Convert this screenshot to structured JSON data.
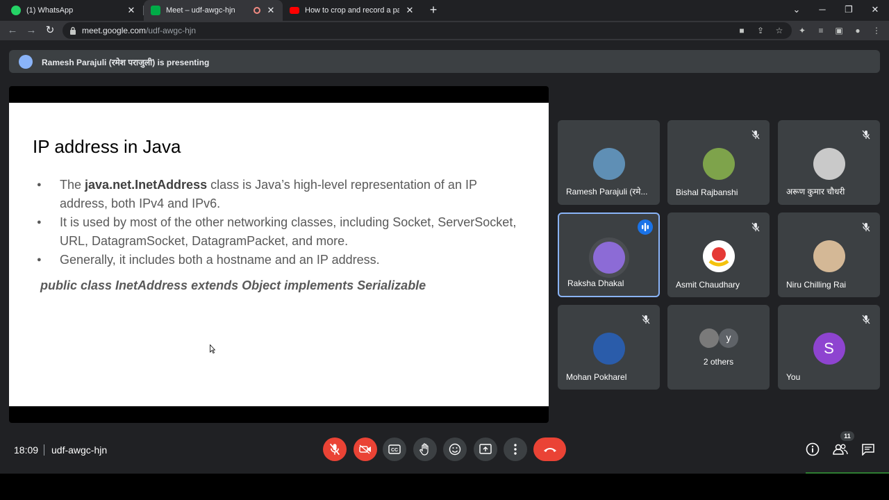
{
  "browser": {
    "tabs": [
      {
        "title": "(1) WhatsApp",
        "favicon": "whatsapp-icon",
        "color": "#25d366"
      },
      {
        "title": "Meet – udf-awgc-hjn",
        "favicon": "meet-icon",
        "color": "#00ac47"
      },
      {
        "title": "How to crop and record a partic",
        "favicon": "youtube-icon",
        "color": "#ff0000"
      }
    ],
    "url_host": "meet.google.com",
    "url_path": "/udf-awgc-hjn"
  },
  "meet": {
    "presenting_text": "Ramesh Parajuli (रमेश पराजुली) is presenting",
    "slide": {
      "title": "IP address in Java",
      "bullet1_pre": "The ",
      "bullet1_bold": "java.net.InetAddress",
      "bullet1_post": " class is Java’s high-level representation of an IP address, both IPv4 and IPv6.",
      "bullet2": "It is used by most of the other networking classes, including Socket, ServerSocket, URL, DatagramSocket, DatagramPacket, and more.",
      "bullet3": "Generally, it includes both a hostname and an IP address.",
      "signature": "public class InetAddress extends Object implements Serializable"
    },
    "participants": [
      {
        "name": "Ramesh Parajuli (रमे...",
        "muted": false,
        "avatar_color": "#5f8fb5"
      },
      {
        "name": "Bishal Rajbanshi",
        "muted": true,
        "avatar_color": "#7ea34b"
      },
      {
        "name": "अरूण कुमार चौधरी",
        "muted": true,
        "avatar_color": "#c9c9c9"
      },
      {
        "name": "Raksha Dhakal",
        "muted": false,
        "speaking": true,
        "avatar_color": "#8c6bd6"
      },
      {
        "name": "Asmit Chaudhary",
        "muted": true,
        "avatar_color": "#ffffff"
      },
      {
        "name": "Niru Chilling Rai",
        "muted": true,
        "avatar_color": "#d4b896"
      },
      {
        "name": "Mohan Pokharel",
        "muted": true,
        "avatar_color": "#2a5caa"
      },
      {
        "name": "2 others",
        "muted": false,
        "avatar_color": "#7a7a7a",
        "small_avatar_letter": "y"
      },
      {
        "name": "You",
        "muted": true,
        "avatar_color": "#8e44d0",
        "letter": "S"
      }
    ],
    "clock": "18:09",
    "meeting_code": "udf-awgc-hjn",
    "people_count": "11"
  }
}
